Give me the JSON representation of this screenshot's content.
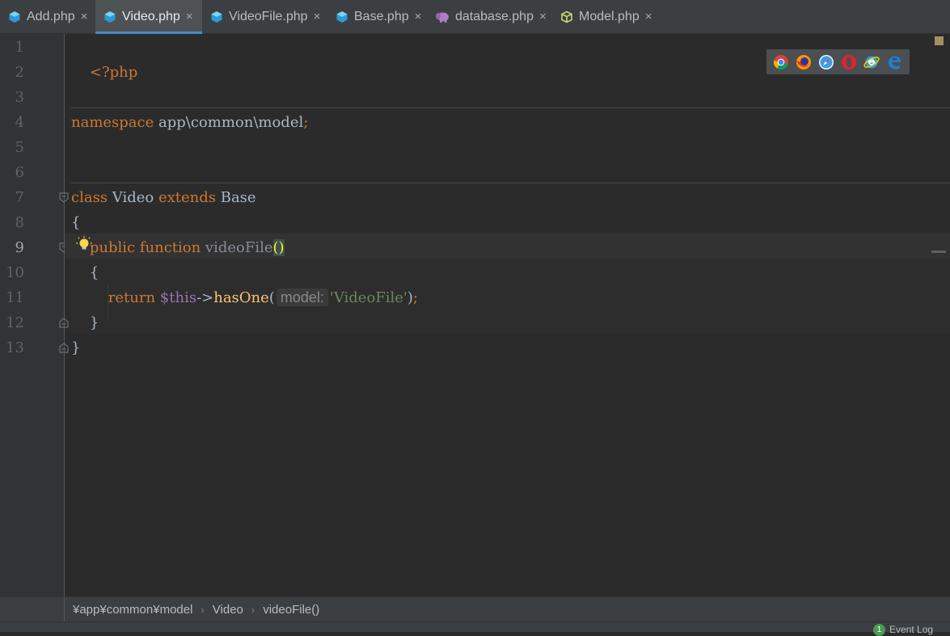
{
  "tabs": [
    {
      "label": "Add.php",
      "icon": "php-class-icon",
      "active": false
    },
    {
      "label": "Video.php",
      "icon": "php-class-icon",
      "active": true
    },
    {
      "label": "VideoFile.php",
      "icon": "php-class-icon",
      "active": false
    },
    {
      "label": "Base.php",
      "icon": "php-class-icon",
      "active": false
    },
    {
      "label": "database.php",
      "icon": "php-elephant-icon",
      "active": false
    },
    {
      "label": "Model.php",
      "icon": "model-cube-icon",
      "active": false
    }
  ],
  "tab_close_glyph": "×",
  "line_numbers": [
    "1",
    "2",
    "3",
    "4",
    "5",
    "6",
    "7",
    "8",
    "9",
    "10",
    "11",
    "12",
    "13"
  ],
  "current_line": "9",
  "code": {
    "l1": {
      "open_tag": "<?php"
    },
    "l4": {
      "kw": "namespace",
      "ns": " app\\common\\model",
      "semi": ";"
    },
    "l7": {
      "kw1": "class",
      "name": " Video ",
      "kw2": "extends",
      "base": " Base"
    },
    "l8": {
      "brace": "{"
    },
    "l9": {
      "indent": "    ",
      "kw1": "public",
      "kw2": " function",
      "fn": " videoFile",
      "parens": "()"
    },
    "l10": {
      "text": "    {"
    },
    "l11": {
      "indent": "        ",
      "kw": "return",
      "var": " $this",
      "arrow": "->",
      "call": "hasOne",
      "open": "(",
      "hint": "model:",
      "str": "'VideoFile'",
      "close": ")",
      "semi": ";"
    },
    "l12": {
      "text": "    }"
    },
    "l13": {
      "text": "}"
    }
  },
  "browsers": [
    "chrome-icon",
    "firefox-icon",
    "safari-icon",
    "opera-icon",
    "internet-explorer-icon",
    "edge-icon"
  ],
  "colors": {
    "keyword": "#cc7832",
    "text": "#a9b7c6",
    "string": "#6a8759",
    "variable": "#9876aa",
    "method": "#ffc66d",
    "accent": "#4a88c7"
  },
  "breadcrumbs": [
    "¥app¥common¥model",
    "Video",
    "videoFile()"
  ],
  "breadcrumb_separator": "›",
  "event_log": {
    "count": "1",
    "label": "Event Log"
  }
}
